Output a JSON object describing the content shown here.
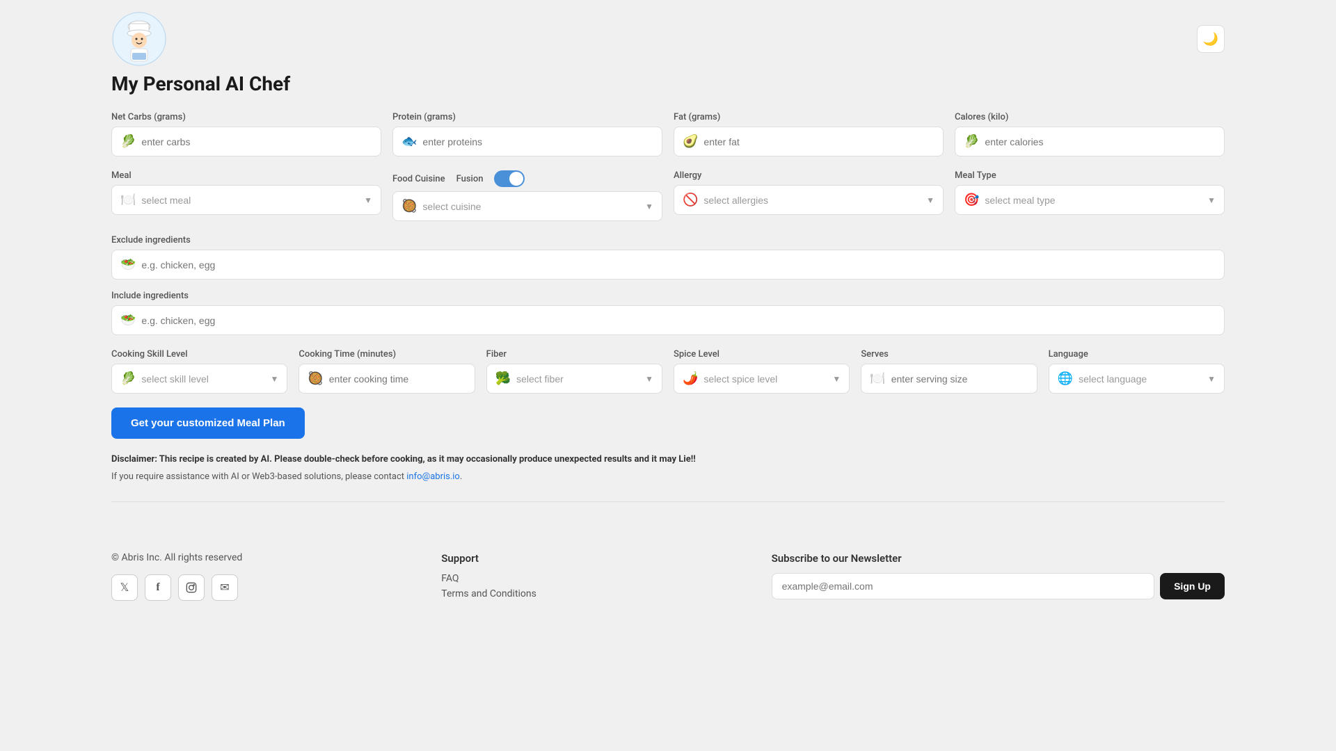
{
  "header": {
    "logo_emoji": "👨‍🍳",
    "title": "My Personal AI Chef",
    "dark_mode_icon": "🌙"
  },
  "form": {
    "net_carbs": {
      "label": "Net Carbs (grams)",
      "placeholder": "enter carbs",
      "icon": "🥬"
    },
    "protein": {
      "label": "Protein (grams)",
      "placeholder": "enter proteins",
      "icon": "🐟"
    },
    "fat": {
      "label": "Fat (grams)",
      "placeholder": "enter fat",
      "icon": "🥑"
    },
    "calories": {
      "label": "Calores (kilo)",
      "placeholder": "enter calories",
      "icon": "🥬"
    },
    "meal": {
      "label": "Meal",
      "placeholder": "select meal",
      "icon": "🍽️"
    },
    "food_cuisine": {
      "label": "Food Cuisine",
      "placeholder": "select cuisine",
      "icon": "🥘"
    },
    "fusion": {
      "label": "Fusion"
    },
    "allergy": {
      "label": "Allergy",
      "placeholder": "select allergies",
      "icon": "🚫"
    },
    "meal_type": {
      "label": "Meal Type",
      "placeholder": "select meal type",
      "icon": "🎯"
    },
    "exclude_ingredients": {
      "label": "Exclude ingredients",
      "placeholder": "e.g. chicken, egg",
      "icon": "🥗"
    },
    "include_ingredients": {
      "label": "Include ingredients",
      "placeholder": "e.g. chicken, egg",
      "icon": "🥗"
    },
    "cooking_skill": {
      "label": "Cooking Skill Level",
      "placeholder": "select skill level",
      "icon": "🥬"
    },
    "cooking_time": {
      "label": "Cooking Time (minutes)",
      "placeholder": "enter cooking time",
      "icon": "🥘"
    },
    "fiber": {
      "label": "Fiber",
      "placeholder": "select fiber",
      "icon": "🥦"
    },
    "spice_level": {
      "label": "Spice Level",
      "placeholder": "select spice level",
      "icon": "🌶️"
    },
    "serves": {
      "label": "Serves",
      "placeholder": "enter serving size",
      "icon": "🍽️"
    },
    "language": {
      "label": "Language",
      "placeholder": "select language",
      "icon": "🌐"
    },
    "get_plan_button": "Get your customized Meal Plan"
  },
  "disclaimer": {
    "text1": "Disclaimer: This recipe is created by AI. Please double-check before cooking, as it may occasionally produce unexpected results and it may Lie!!",
    "text2": "If you require assistance with AI or Web3-based solutions, please contact ",
    "email": "info@abris.io",
    "text3": "."
  },
  "footer": {
    "copyright": "© Abris Inc. All rights reserved",
    "socials": [
      {
        "name": "twitter",
        "icon": "𝕏"
      },
      {
        "name": "facebook",
        "icon": "f"
      },
      {
        "name": "instagram",
        "icon": "📷"
      },
      {
        "name": "email",
        "icon": "✉"
      }
    ],
    "support": {
      "title": "Support",
      "links": [
        "FAQ",
        "Terms and Conditions"
      ]
    },
    "newsletter": {
      "title": "Subscribe to our Newsletter",
      "placeholder": "example@email.com",
      "button": "Sign Up"
    }
  }
}
